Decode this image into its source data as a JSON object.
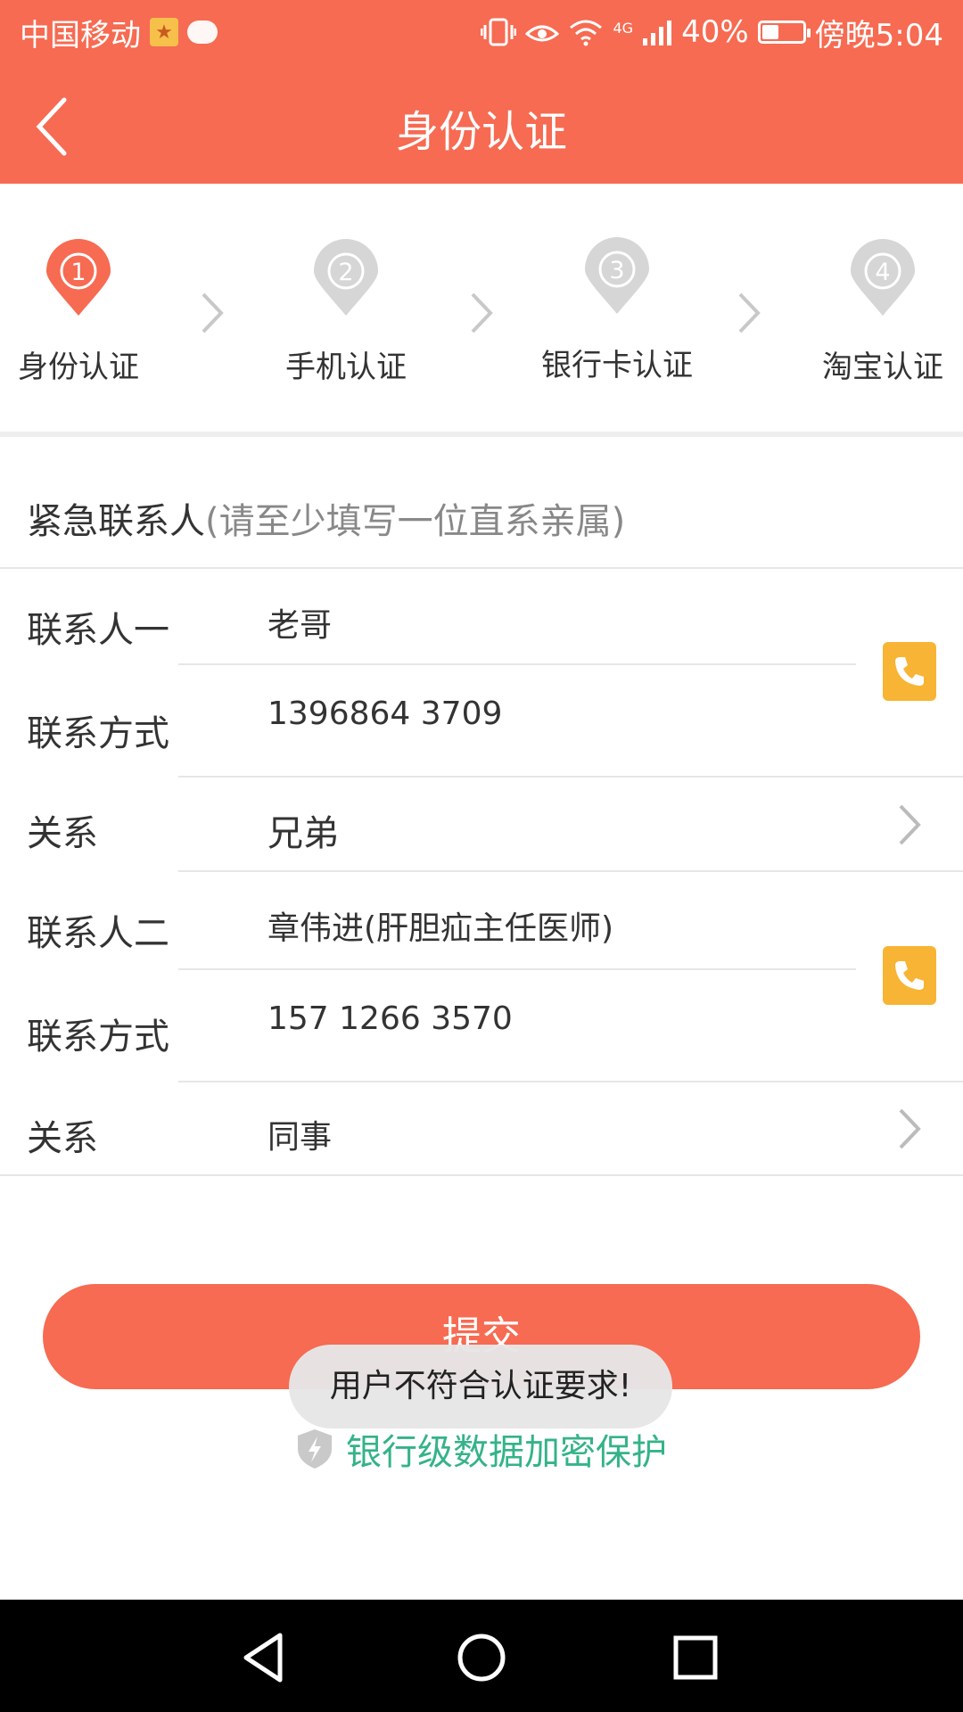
{
  "status_bar": {
    "carrier": "中国移动",
    "battery_text": "40%",
    "battery_level": 0.4,
    "time": "傍晚5:04",
    "network": "4G"
  },
  "header": {
    "title": "身份认证"
  },
  "steps": [
    {
      "number": "1",
      "label": "身份认证",
      "active": true
    },
    {
      "number": "2",
      "label": "手机认证",
      "active": false
    },
    {
      "number": "3",
      "label": "银行卡认证",
      "active": false
    },
    {
      "number": "4",
      "label": "淘宝认证",
      "active": false
    }
  ],
  "section": {
    "title": "紧急联系人",
    "hint": "(请至少填写一位直系亲属)"
  },
  "contacts": [
    {
      "name_label": "联系人一",
      "name": "老哥",
      "phone_label": "联系方式",
      "phone": "1396864 3709",
      "relation_label": "关系",
      "relation": "兄弟"
    },
    {
      "name_label": "联系人二",
      "name": "章伟进(肝胆疝主任医师)",
      "phone_label": "联系方式",
      "phone": "157 1266 3570",
      "relation_label": "关系",
      "relation": "同事"
    }
  ],
  "submit": {
    "label": "提交"
  },
  "toast": {
    "message": "用户不符合认证要求!"
  },
  "security": {
    "text": "银行级数据加密保护"
  },
  "colors": {
    "accent": "#F66B52",
    "phone_button": "#F8B434",
    "secure_green": "#34B388",
    "inactive_step": "#D6D6D6"
  }
}
